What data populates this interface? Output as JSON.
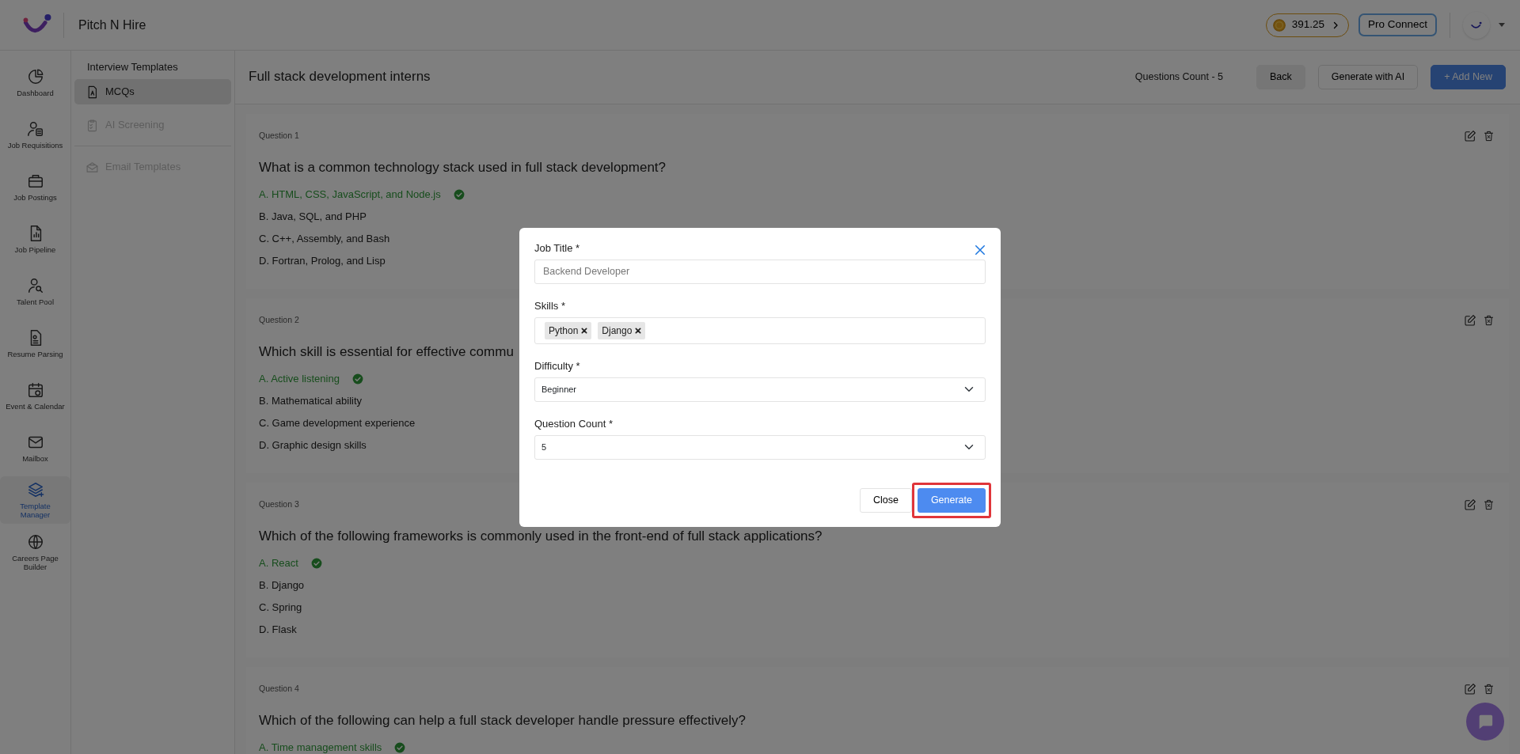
{
  "header": {
    "brand": "Pitch N Hire",
    "credits": "391.25",
    "pro_button": "Pro Connect"
  },
  "nav": [
    {
      "label": "Dashboard",
      "selected": false
    },
    {
      "label": "Job Requisitions",
      "selected": false
    },
    {
      "label": "Job Postings",
      "selected": false
    },
    {
      "label": "Job Pipeline",
      "selected": false
    },
    {
      "label": "Talent Pool",
      "selected": false
    },
    {
      "label": "Resume Parsing",
      "selected": false
    },
    {
      "label": "Event & Calendar",
      "selected": false
    },
    {
      "label": "Mailbox",
      "selected": false
    },
    {
      "label": "Template Manager",
      "selected": true
    },
    {
      "label": "Careers Page Builder",
      "selected": false
    }
  ],
  "templates": {
    "heading": "Interview Templates",
    "items": [
      {
        "label": "MCQs",
        "selected": true,
        "disabled": false
      },
      {
        "label": "AI Screening",
        "selected": false,
        "disabled": true
      },
      {
        "label": "Email Templates",
        "selected": false,
        "disabled": true
      }
    ]
  },
  "page": {
    "title": "Full stack development interns",
    "count": "Questions Count - 5",
    "buttons": [
      {
        "label": "Back",
        "kind": "light"
      },
      {
        "label": "Generate with AI",
        "kind": "outline"
      },
      {
        "label": "+ Add New",
        "kind": "primary"
      }
    ]
  },
  "questions": [
    {
      "label": "Question 1",
      "text": "What is a common technology stack used in full stack development?",
      "options": [
        {
          "text": "A. HTML, CSS, JavaScript, and Node.js",
          "correct": true
        },
        {
          "text": "B. Java, SQL, and PHP",
          "correct": false
        },
        {
          "text": "C. C++, Assembly, and Bash",
          "correct": false
        },
        {
          "text": "D. Fortran, Prolog, and Lisp",
          "correct": false
        }
      ]
    },
    {
      "label": "Question 2",
      "text": "Which skill is essential for effective commu",
      "options": [
        {
          "text": "A. Active listening",
          "correct": true
        },
        {
          "text": "B. Mathematical ability",
          "correct": false
        },
        {
          "text": "C. Game development experience",
          "correct": false
        },
        {
          "text": "D. Graphic design skills",
          "correct": false
        }
      ]
    },
    {
      "label": "Question 3",
      "text": "Which of the following frameworks is commonly used in the front-end of full stack applications?",
      "options": [
        {
          "text": "A. React",
          "correct": true
        },
        {
          "text": "B. Django",
          "correct": false
        },
        {
          "text": "C. Spring",
          "correct": false
        },
        {
          "text": "D. Flask",
          "correct": false
        }
      ]
    },
    {
      "label": "Question 4",
      "text": "Which of the following can help a full stack developer handle pressure effectively?",
      "options": [
        {
          "text": "A. Time management skills",
          "correct": true
        }
      ]
    }
  ],
  "modal": {
    "fields": [
      {
        "kind": "text",
        "label": "Job Title *",
        "placeholder": "Backend Developer"
      },
      {
        "kind": "tags",
        "label": "Skills *",
        "tags": [
          "Python",
          "Django"
        ]
      },
      {
        "kind": "select",
        "label": "Difficulty *",
        "value": "Beginner"
      },
      {
        "kind": "select",
        "label": "Question Count *",
        "value": "5"
      }
    ],
    "close_button": "Close",
    "generate_button": {
      "label": "Generate",
      "highlighted": true
    }
  }
}
